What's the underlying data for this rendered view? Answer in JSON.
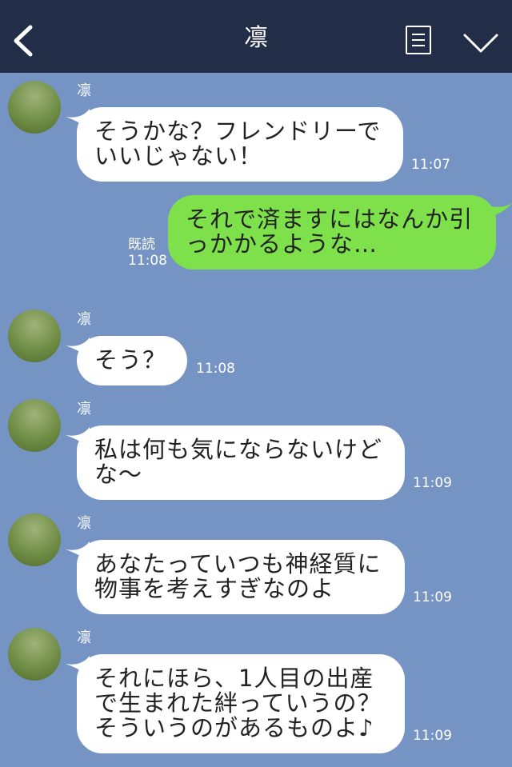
{
  "header": {
    "title": "凛"
  },
  "messages": [
    {
      "sender": "凛",
      "text": "そうかな？フレンドリーでいいじゃない！",
      "time": "11:07"
    },
    {
      "read": "既読",
      "text": "それで済ますにはなんか引っかかるような…",
      "time": "11:08"
    },
    {
      "sender": "凛",
      "text": "そう？",
      "time": "11:08"
    },
    {
      "sender": "凛",
      "text": "私は何も気にならないけどな〜",
      "time": "11:09"
    },
    {
      "sender": "凛",
      "text": "あなたっていつも神経質に物事を考えすぎなのよ",
      "time": "11:09"
    },
    {
      "sender": "凛",
      "text": "それにほら、1人目の出産で生まれた絆っていうの？そういうのがあるものよ♪",
      "time": "11:09"
    }
  ],
  "colors": {
    "header": "#222e47",
    "background": "#7594c4",
    "outgoing": "#7ee04a",
    "incoming": "#ffffff"
  },
  "icons": [
    "back-chevron-icon",
    "menu-icon",
    "collapse-chevron-icon",
    "avatar-icon"
  ]
}
